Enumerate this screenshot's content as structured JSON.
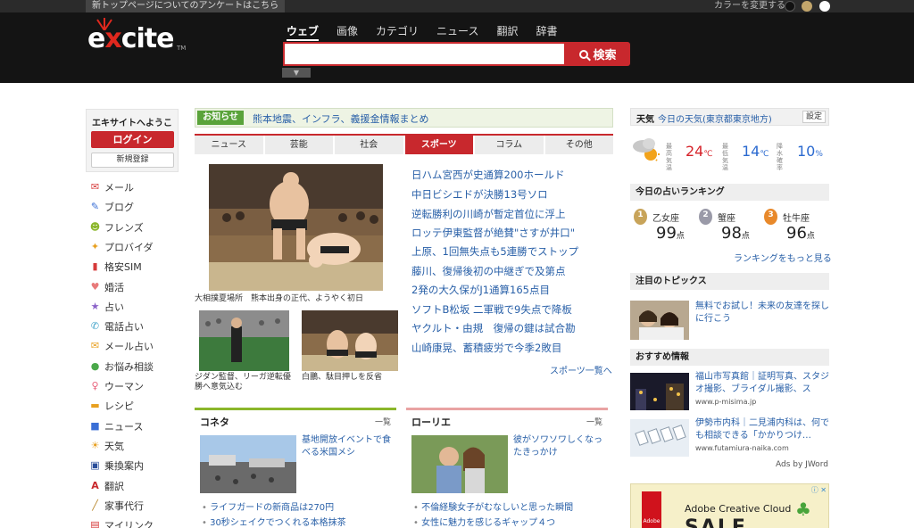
{
  "topbar": {
    "survey": "新トップページについてのアンケートはこちら",
    "color_label": "カラーを変更する",
    "swatches": [
      "#111111",
      "#c2a56b",
      "#ffffff"
    ]
  },
  "header": {
    "logo": "excite",
    "logo_first": "e",
    "logo_x": "x",
    "logo_rest": "cite",
    "tm": "TM",
    "nav": [
      "ウェブ",
      "画像",
      "カテゴリ",
      "ニュース",
      "翻訳",
      "辞書"
    ],
    "search_button": "検索",
    "search_value": "",
    "dropdown": "▼"
  },
  "sidebar": {
    "welcome": "エキサイトへようこそ",
    "login": "ログイン",
    "signup": "新規登録",
    "services": [
      {
        "label": "メール",
        "icon": "mail-icon",
        "glyph": "✉",
        "color": "#d63a3a"
      },
      {
        "label": "ブログ",
        "icon": "pencil-icon",
        "glyph": "✎",
        "color": "#3a6fd6"
      },
      {
        "label": "フレンズ",
        "icon": "friends-icon",
        "glyph": "☻",
        "color": "#8bb62b"
      },
      {
        "label": "プロバイダ",
        "icon": "provider-icon",
        "glyph": "✦",
        "color": "#e8a020"
      },
      {
        "label": "格安SIM",
        "icon": "sim-icon",
        "glyph": "▮",
        "color": "#d63a3a"
      },
      {
        "label": "婚活",
        "icon": "couple-icon",
        "glyph": "♥",
        "color": "#e87a7a"
      },
      {
        "label": "占い",
        "icon": "star-icon",
        "glyph": "★",
        "color": "#8a62c8"
      },
      {
        "label": "電話占い",
        "icon": "phone-icon",
        "glyph": "✆",
        "color": "#3aa0c8"
      },
      {
        "label": "メール占い",
        "icon": "mail-fortune-icon",
        "glyph": "✉",
        "color": "#e8a020"
      },
      {
        "label": "お悩み相談",
        "icon": "chat-icon",
        "glyph": "●",
        "color": "#4aa84a"
      },
      {
        "label": "ウーマン",
        "icon": "woman-icon",
        "glyph": "♀",
        "color": "#e8607a"
      },
      {
        "label": "レシピ",
        "icon": "recipe-icon",
        "glyph": "▬",
        "color": "#e8a020"
      },
      {
        "label": "ニュース",
        "icon": "news-icon",
        "glyph": "■",
        "color": "#3a6fd6"
      },
      {
        "label": "天気",
        "icon": "weather-icon",
        "glyph": "☀",
        "color": "#e8a020"
      },
      {
        "label": "乗換案内",
        "icon": "train-icon",
        "glyph": "▣",
        "color": "#2b4e9a"
      },
      {
        "label": "翻訳",
        "icon": "translate-icon",
        "glyph": "A",
        "color": "#c8282d"
      },
      {
        "label": "家事代行",
        "icon": "broom-icon",
        "glyph": "╱",
        "color": "#b8862b"
      },
      {
        "label": "マイリンク",
        "icon": "mylink-icon",
        "glyph": "▤",
        "color": "#d63a3a"
      }
    ]
  },
  "notice": {
    "tag": "お知らせ",
    "text": "熊本地震、インフラ、義援金情報まとめ"
  },
  "tabs": [
    "ニュース",
    "芸能",
    "社会",
    "スポーツ",
    "コラム",
    "その他"
  ],
  "active_tab": 3,
  "feature": {
    "main_caption": "大相撲夏場所　熊本出身の正代、ようやく初日",
    "sub1_caption": "ジダン監督、リーガ逆転優勝へ意気込む",
    "sub2_caption": "白鵬、駄目押しを反省"
  },
  "headlines": [
    "日ハム宮西が史通算200ホールド",
    "中日ビシエドが決勝13号ソロ",
    "逆転勝利の川崎が暫定首位に浮上",
    "ロッテ伊東監督が絶賛\"さすが井口\"",
    "上原、1回無失点も5連勝でストップ",
    "藤川、復帰後初の中継ぎで及第点",
    "2発の大久保がJ1通算165点目",
    "ソフトB松坂 二軍戦で9失点で降板",
    "ヤクルト・由規　復帰の鍵は試合勘",
    "山崎康晃、蓄積疲労で今季2敗目"
  ],
  "more_sports": "スポーツ一覧へ",
  "boxes": [
    {
      "title": "コネタ",
      "more": "一覧",
      "desc": "基地開放イベントで食べる米国メシ",
      "links": [
        "ライフガードの新商品は270円",
        "30秒シェイクでつくれる本格抹茶"
      ]
    },
    {
      "title": "ローリエ",
      "more": "一覧",
      "desc": "彼がソワソワしくなったきっかけ",
      "links": [
        "不倫経験女子がむなしいと思った瞬間",
        "女性に魅力を感じるギャップ４つ"
      ]
    }
  ],
  "weather": {
    "label": "天気",
    "location": "今日の天気(東京都東京地方)",
    "settings": "設定",
    "high_label": "最高気温",
    "high": "24",
    "low_label": "最低気温",
    "low": "14",
    "rain_label": "降水確率",
    "rain": "10",
    "deg": "℃",
    "pct": "%"
  },
  "ranking": {
    "title": "今日の占いランキング",
    "unit": "点",
    "items": [
      {
        "rank": "1",
        "name": "乙女座",
        "points": "99",
        "color": "#c8a45a"
      },
      {
        "rank": "2",
        "name": "蟹座",
        "points": "98",
        "color": "#9a9aa8"
      },
      {
        "rank": "3",
        "name": "牡牛座",
        "points": "96",
        "color": "#e8892b"
      }
    ],
    "more": "ランキングをもっと見る"
  },
  "topics": {
    "title": "注目のトピックス",
    "text": "無料でお試し！未来の友達を探しに行こう"
  },
  "recommend": {
    "title": "おすすめ情報",
    "items": [
      {
        "text": "福山市写真館｜証明写真、スタジオ撮影、ブライダル撮影、ス",
        "url": "www.p-misima.jp"
      },
      {
        "text": "伊勢市内科｜二見浦内科は、何でも相談できる「かかりつけ…",
        "url": "www.futamiura-naika.com"
      }
    ],
    "ads_by": "Ads by JWord"
  },
  "banner": {
    "logo": "Adobe",
    "text": "Adobe Creative Cloud",
    "big": "SALE",
    "badge": "ⓘ ✕"
  },
  "colors": {
    "accent": "#c8282d",
    "link": "#2960a8",
    "notice_green": "#5aa33a",
    "temp_high": "#d6232a",
    "temp_low": "#2b6ad0"
  }
}
